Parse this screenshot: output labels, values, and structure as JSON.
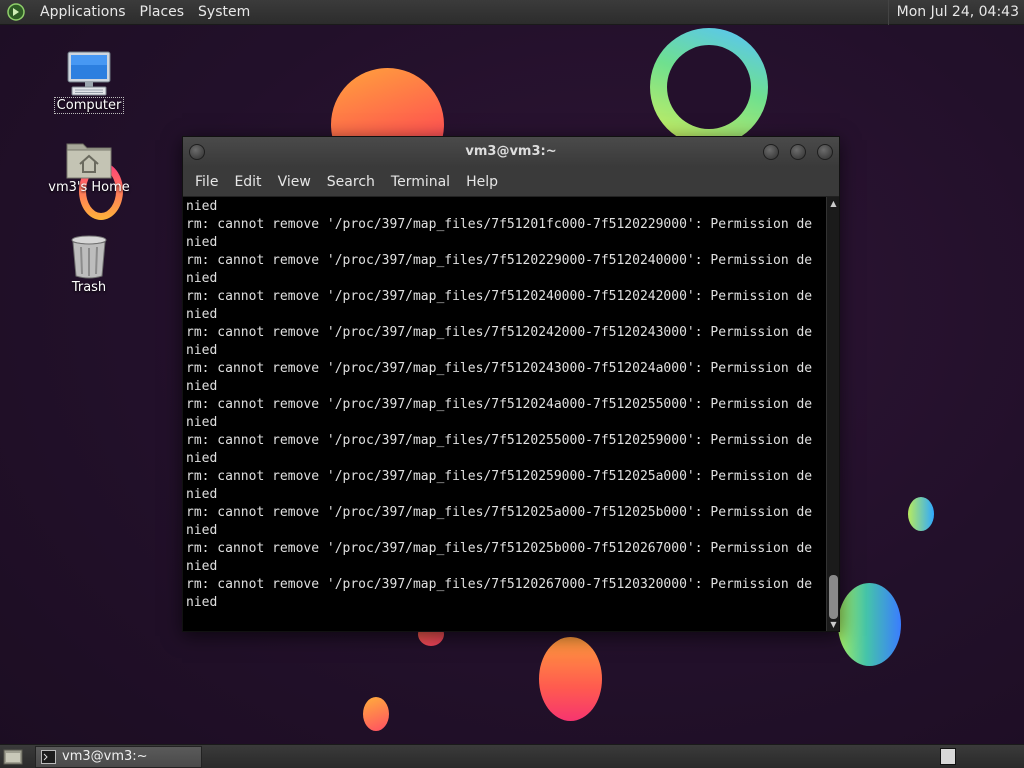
{
  "top_panel": {
    "menus": [
      "Applications",
      "Places",
      "System"
    ],
    "clock": "Mon Jul 24, 04:43"
  },
  "desktop": {
    "icons": [
      {
        "label": "Computer",
        "icon": "computer-icon"
      },
      {
        "label": "vm3's Home",
        "icon": "home-folder-icon"
      },
      {
        "label": "Trash",
        "icon": "trash-icon"
      }
    ]
  },
  "terminal": {
    "title": "vm3@vm3:~",
    "menu": [
      "File",
      "Edit",
      "View",
      "Search",
      "Terminal",
      "Help"
    ],
    "lines": [
      "nied",
      "rm: cannot remove '/proc/397/map_files/7f51201fc000-7f5120229000': Permission de",
      "nied",
      "rm: cannot remove '/proc/397/map_files/7f5120229000-7f5120240000': Permission de",
      "nied",
      "rm: cannot remove '/proc/397/map_files/7f5120240000-7f5120242000': Permission de",
      "nied",
      "rm: cannot remove '/proc/397/map_files/7f5120242000-7f5120243000': Permission de",
      "nied",
      "rm: cannot remove '/proc/397/map_files/7f5120243000-7f512024a000': Permission de",
      "nied",
      "rm: cannot remove '/proc/397/map_files/7f512024a000-7f5120255000': Permission de",
      "nied",
      "rm: cannot remove '/proc/397/map_files/7f5120255000-7f5120259000': Permission de",
      "nied",
      "rm: cannot remove '/proc/397/map_files/7f5120259000-7f512025a000': Permission de",
      "nied",
      "rm: cannot remove '/proc/397/map_files/7f512025a000-7f512025b000': Permission de",
      "nied",
      "rm: cannot remove '/proc/397/map_files/7f512025b000-7f5120267000': Permission de",
      "nied",
      "rm: cannot remove '/proc/397/map_files/7f5120267000-7f5120320000': Permission de",
      "nied"
    ]
  },
  "taskbar": {
    "tasks": [
      {
        "label": "vm3@vm3:~",
        "icon": "terminal-icon"
      }
    ]
  }
}
